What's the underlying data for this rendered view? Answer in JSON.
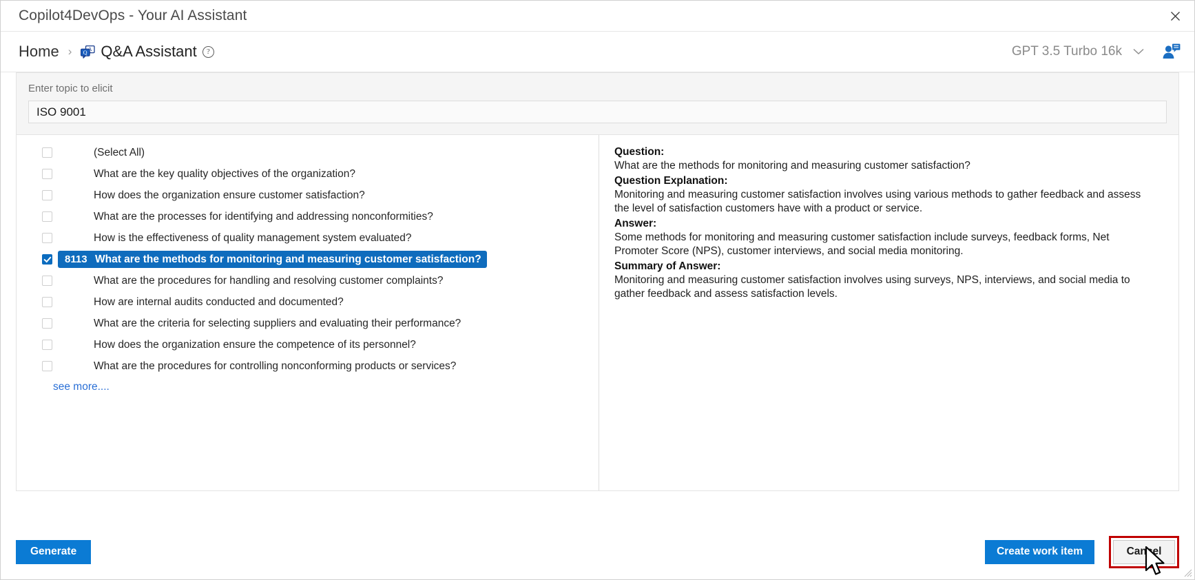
{
  "window": {
    "title": "Copilot4DevOps - Your AI Assistant",
    "close_label": "✕"
  },
  "breadcrumb": {
    "home": "Home",
    "separator": "›",
    "current": "Q&A Assistant",
    "qa_icon": "qa-chat-icon",
    "help_icon": "help-circle-icon"
  },
  "header": {
    "model": "GPT 3.5 Turbo 16k",
    "model_chevron": "⌄",
    "user_icon": "user-chat-icon"
  },
  "topic": {
    "label": "Enter topic to elicit",
    "value": "ISO 9001",
    "placeholder": "Enter topic to elicit"
  },
  "questions": [
    {
      "id": "",
      "text": "(Select All)",
      "checked": false,
      "selected": false
    },
    {
      "id": "",
      "text": "What are the key quality objectives of the organization?",
      "checked": false,
      "selected": false
    },
    {
      "id": "",
      "text": "How does the organization ensure customer satisfaction?",
      "checked": false,
      "selected": false
    },
    {
      "id": "",
      "text": "What are the processes for identifying and addressing nonconformities?",
      "checked": false,
      "selected": false
    },
    {
      "id": "",
      "text": "How is the effectiveness of quality management system evaluated?",
      "checked": false,
      "selected": false
    },
    {
      "id": "8113",
      "text": "What are the methods for monitoring and measuring customer satisfaction?",
      "checked": true,
      "selected": true
    },
    {
      "id": "",
      "text": "What are the procedures for handling and resolving customer complaints?",
      "checked": false,
      "selected": false
    },
    {
      "id": "",
      "text": "How are internal audits conducted and documented?",
      "checked": false,
      "selected": false
    },
    {
      "id": "",
      "text": "What are the criteria for selecting suppliers and evaluating their performance?",
      "checked": false,
      "selected": false
    },
    {
      "id": "",
      "text": "How does the organization ensure the competence of its personnel?",
      "checked": false,
      "selected": false
    },
    {
      "id": "",
      "text": "What are the procedures for controlling nonconforming products or services?",
      "checked": false,
      "selected": false
    }
  ],
  "see_more": "see more....",
  "answer_panel": {
    "question_label": "Question:",
    "question_text": "What are the methods for monitoring and measuring customer satisfaction?",
    "explanation_label": "Question Explanation:",
    "explanation_text": "Monitoring and measuring customer satisfaction involves using various methods to gather feedback and assess the level of satisfaction customers have with a product or service.",
    "answer_label": "Answer:",
    "answer_text": "Some methods for monitoring and measuring customer satisfaction include surveys, feedback forms, Net Promoter Score (NPS), customer interviews, and social media monitoring.",
    "summary_label": "Summary of Answer:",
    "summary_text": "Monitoring and measuring customer satisfaction involves using surveys, NPS, interviews, and social media to gather feedback and assess satisfaction levels."
  },
  "footer": {
    "generate": "Generate",
    "create_work_item": "Create work item",
    "cancel": "Cancel"
  },
  "colors": {
    "accent_blue": "#0b7bd4",
    "selected_row": "#0f6cbd",
    "link_blue": "#2a6fd6",
    "annotation_red": "#c00000"
  }
}
